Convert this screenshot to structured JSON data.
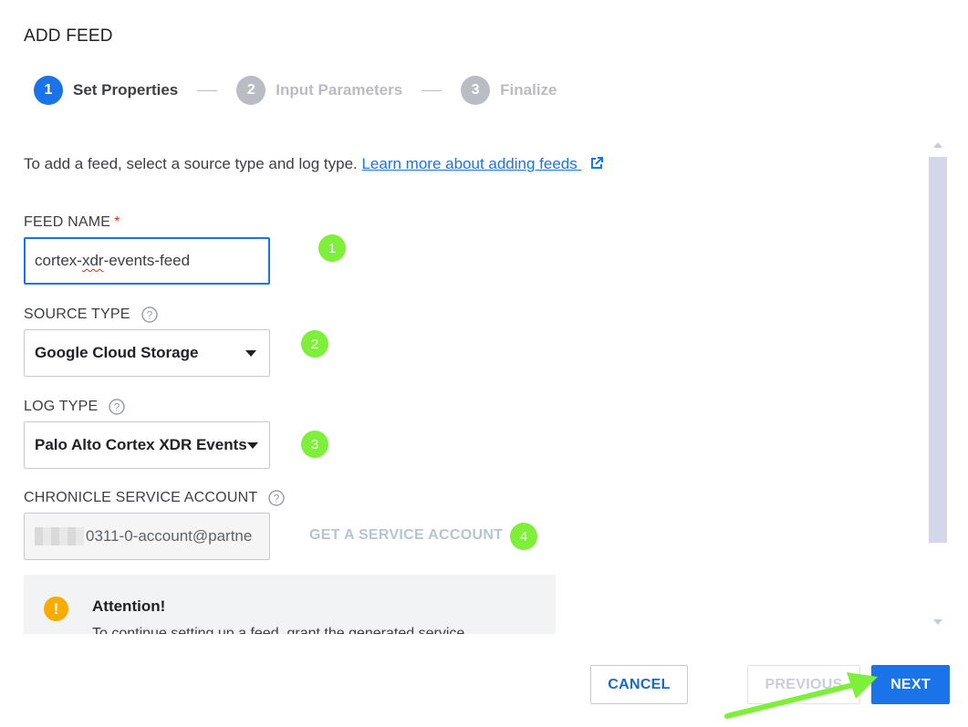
{
  "dialog": {
    "title": "ADD FEED"
  },
  "stepper": {
    "steps": [
      {
        "number": "1",
        "label": "Set Properties"
      },
      {
        "number": "2",
        "label": "Input Parameters"
      },
      {
        "number": "3",
        "label": "Finalize"
      }
    ],
    "active_step": 1
  },
  "intro": {
    "text": "To add a feed, select a source type and log type. ",
    "link_text": "Learn more about adding feeds "
  },
  "fields": {
    "feed_name": {
      "label": "FEED NAME",
      "required_mark": "*",
      "value_prefix": "cortex-",
      "value_misspelled": "xdr",
      "value_suffix": "-events-feed"
    },
    "source_type": {
      "label": "SOURCE TYPE",
      "value": "Google Cloud Storage"
    },
    "log_type": {
      "label": "LOG TYPE",
      "value": "Palo Alto Cortex XDR Events"
    },
    "service_account": {
      "label": "CHRONICLE SERVICE ACCOUNT",
      "value": "0311-0-account@partne"
    }
  },
  "get_service_account": {
    "label": "GET A SERVICE ACCOUNT"
  },
  "annotations": [
    "1",
    "2",
    "3",
    "4"
  ],
  "attention": {
    "title": "Attention!",
    "body": "To continue setting up a feed, grant the generated service"
  },
  "footer": {
    "cancel_label": "CANCEL",
    "previous_label": "PREVIOUS",
    "next_label": "NEXT"
  },
  "colors": {
    "primary": "#1a73e8",
    "annotation_green": "#7ef03a",
    "warning": "#f9ab00",
    "disabled": "#b9bcc2"
  },
  "icons": [
    "external-link-icon",
    "help-icon",
    "dropdown-caret-icon",
    "warning-icon",
    "scroll-up-icon",
    "scroll-down-icon",
    "annotation-arrow"
  ]
}
